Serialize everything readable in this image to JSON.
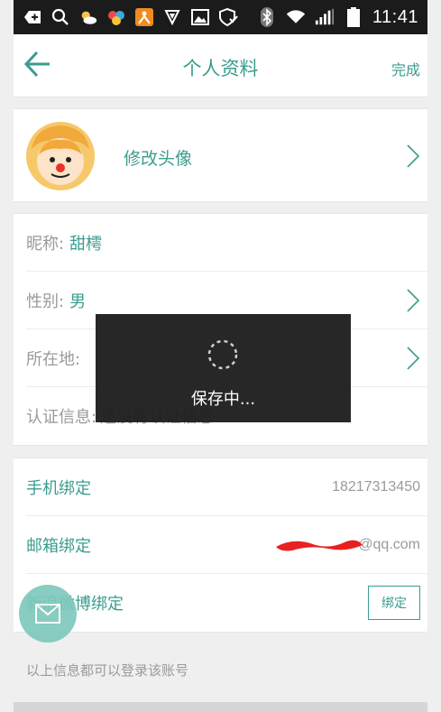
{
  "status_bar": {
    "time": "11:41"
  },
  "header": {
    "title": "个人资料",
    "done_label": "完成"
  },
  "avatar_section": {
    "label": "修改头像"
  },
  "profile": {
    "nickname_label": "昵称:",
    "nickname_value": "甜樗",
    "gender_label": "性别:",
    "gender_value": "男",
    "location_label": "所在地:",
    "location_value": "",
    "verify_label": "认证信息:",
    "verify_value": "还没有认证信息"
  },
  "bindings": {
    "phone_label": "手机绑定",
    "phone_value": "18217313450",
    "email_label": "邮箱绑定",
    "email_value": "@qq.com",
    "weibo_label": "新浪微博绑定",
    "weibo_button": "绑定"
  },
  "footer": {
    "note": "以上信息都可以登录该账号"
  },
  "toast": {
    "message": "保存中..."
  },
  "colors": {
    "accent": "#3a9d8f",
    "status_bar": "#1b1b1b",
    "toast_bg": "#1e1e1e"
  }
}
